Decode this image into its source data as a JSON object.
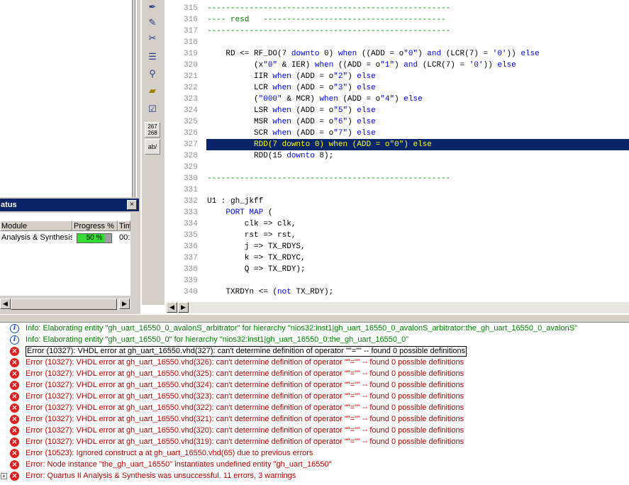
{
  "status_panel": {
    "title": "atus",
    "close": "×",
    "columns": [
      "Module",
      "Progress %",
      "Tim"
    ],
    "rows": [
      {
        "module": "Analysis & Synthesis",
        "progress": "50 %",
        "progress_value": 50,
        "time": "00:"
      }
    ]
  },
  "toolbar": {
    "line_numbers_top": "267",
    "line_numbers_bottom": "268",
    "ab_label": "ab/"
  },
  "editor": {
    "lines": [
      {
        "n": "315",
        "text": "----------------------------------------------------"
      },
      {
        "n": "316",
        "text": "---- resd   ---------------------------------------"
      },
      {
        "n": "317",
        "text": "----------------------------------------------------"
      },
      {
        "n": "318",
        "text": ""
      },
      {
        "n": "319",
        "text": "    RD <= RF_DO(7 downto 0) when ((ADD = o\"0\") and (LCR(7) = '0')) else"
      },
      {
        "n": "320",
        "text": "          (x\"0\" & IER) when ((ADD = o\"1\") and (LCR(7) = '0')) else"
      },
      {
        "n": "321",
        "text": "          IIR when (ADD = o\"2\") else"
      },
      {
        "n": "322",
        "text": "          LCR when (ADD = o\"3\") else"
      },
      {
        "n": "323",
        "text": "          (\"000\" & MCR) when (ADD = o\"4\") else"
      },
      {
        "n": "324",
        "text": "          LSR when (ADD = o\"5\") else"
      },
      {
        "n": "325",
        "text": "          MSR when (ADD = o\"6\") else"
      },
      {
        "n": "326",
        "text": "          SCR when (ADD = o\"7\") else"
      },
      {
        "n": "327",
        "text": "          RDD(7 downto 0) when (ADD = o\"0\") else"
      },
      {
        "n": "328",
        "text": "          RDD(15 downto 8);"
      },
      {
        "n": "329",
        "text": ""
      },
      {
        "n": "330",
        "text": "----------------------------------------------------"
      },
      {
        "n": "331",
        "text": ""
      },
      {
        "n": "332",
        "text": "U1 : gh_jkff"
      },
      {
        "n": "333",
        "text": "    PORT MAP ("
      },
      {
        "n": "334",
        "text": "        clk => clk,"
      },
      {
        "n": "335",
        "text": "        rst => rst,"
      },
      {
        "n": "336",
        "text": "        j => TX_RDYS,"
      },
      {
        "n": "337",
        "text": "        k => TX_RDYC,"
      },
      {
        "n": "338",
        "text": "        Q => TX_RDY);"
      },
      {
        "n": "339",
        "text": ""
      },
      {
        "n": "340",
        "text": "    TXRDYn <= (not TX_RDY);"
      }
    ],
    "highlight_line": "327"
  },
  "messages": [
    {
      "type": "info",
      "text": "Info: Elaborating entity \"gh_uart_16550_0_avalonS_arbitrator\" for hierarchy \"nios32:inst1|gh_uart_16550_0_avalonS_arbitrator:the_gh_uart_16550_0_avalonS\""
    },
    {
      "type": "info",
      "text": "Info: Elaborating entity \"gh_uart_16550_0\" for hierarchy \"nios32:inst1|gh_uart_16550_0:the_gh_uart_16550_0\""
    },
    {
      "type": "err",
      "selected": true,
      "text": "Error (10327): VHDL error at gh_uart_16550.vhd(327): can't determine definition of operator \"\"=\"\" -- found 0 possible definitions"
    },
    {
      "type": "err",
      "text": "Error (10327): VHDL error at gh_uart_16550.vhd(326): can't determine definition of operator \"\"=\"\" -- found 0 possible definitions"
    },
    {
      "type": "err",
      "text": "Error (10327): VHDL error at gh_uart_16550.vhd(325): can't determine definition of operator \"\"=\"\" -- found 0 possible definitions"
    },
    {
      "type": "err",
      "text": "Error (10327): VHDL error at gh_uart_16550.vhd(324): can't determine definition of operator \"\"=\"\" -- found 0 possible definitions"
    },
    {
      "type": "err",
      "text": "Error (10327): VHDL error at gh_uart_16550.vhd(323): can't determine definition of operator \"\"=\"\" -- found 0 possible definitions"
    },
    {
      "type": "err",
      "text": "Error (10327): VHDL error at gh_uart_16550.vhd(322): can't determine definition of operator \"\"=\"\" -- found 0 possible definitions"
    },
    {
      "type": "err",
      "text": "Error (10327): VHDL error at gh_uart_16550.vhd(321): can't determine definition of operator \"\"=\"\" -- found 0 possible definitions"
    },
    {
      "type": "err",
      "text": "Error (10327): VHDL error at gh_uart_16550.vhd(320): can't determine definition of operator \"\"=\"\" -- found 0 possible definitions"
    },
    {
      "type": "err",
      "text": "Error (10327): VHDL error at gh_uart_16550.vhd(319): can't determine definition of operator \"\"=\"\" -- found 0 possible definitions"
    },
    {
      "type": "err",
      "text": "Error (10523): Ignored construct a at gh_uart_16550.vhd(65) due to previous errors"
    },
    {
      "type": "err",
      "text": "Error: Node instance \"the_gh_uart_16550\" instantiates undefined entity \"gh_uart_16550\""
    },
    {
      "type": "err",
      "expand": true,
      "text": "Error: Quartus II Analysis & Synthesis was unsuccessful. 11 errors, 3 warnings"
    }
  ],
  "colors": {
    "error": "#c00000",
    "info": "#008000",
    "highlight_bg": "#0a246a",
    "highlight_fg": "#ffff00",
    "keyword": "#0000ff",
    "comment": "#008000"
  }
}
